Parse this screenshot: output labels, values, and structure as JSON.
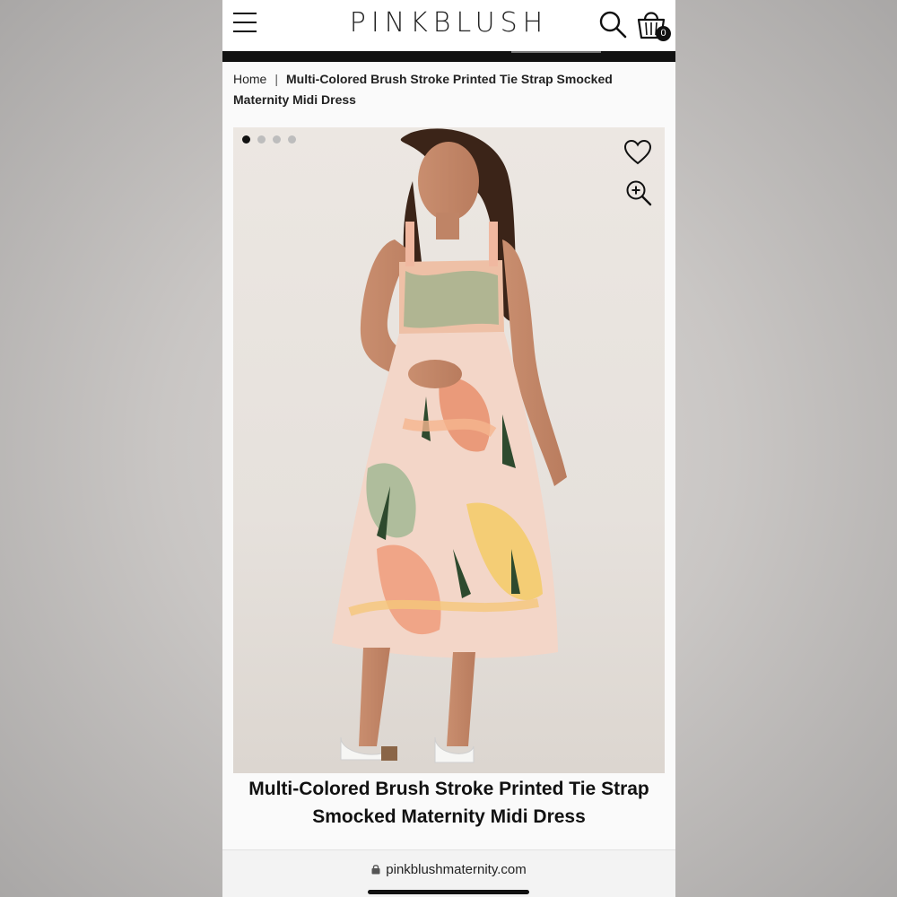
{
  "header": {
    "logo": "PINKBLUSH",
    "cart_count": "0",
    "menu_icon": "hamburger-icon",
    "search_icon": "search-icon",
    "cart_icon": "shopping-bag-icon"
  },
  "breadcrumb": {
    "home": "Home",
    "separator": "|",
    "current": "Multi-Colored Brush Stroke Printed Tie Strap Smocked Maternity Midi Dress"
  },
  "gallery": {
    "image_count": 4,
    "active_index": 0,
    "wishlist_icon": "heart-icon",
    "zoom_icon": "zoom-in-icon"
  },
  "product": {
    "title": "Multi-Colored Brush Stroke Printed Tie Strap Smocked Maternity Midi Dress"
  },
  "browser": {
    "url": "pinkblushmaternity.com",
    "lock_icon": "lock-icon"
  },
  "colors": {
    "page_background": "#c9c6c4",
    "promo_bar": "#111111",
    "text": "#111111"
  }
}
